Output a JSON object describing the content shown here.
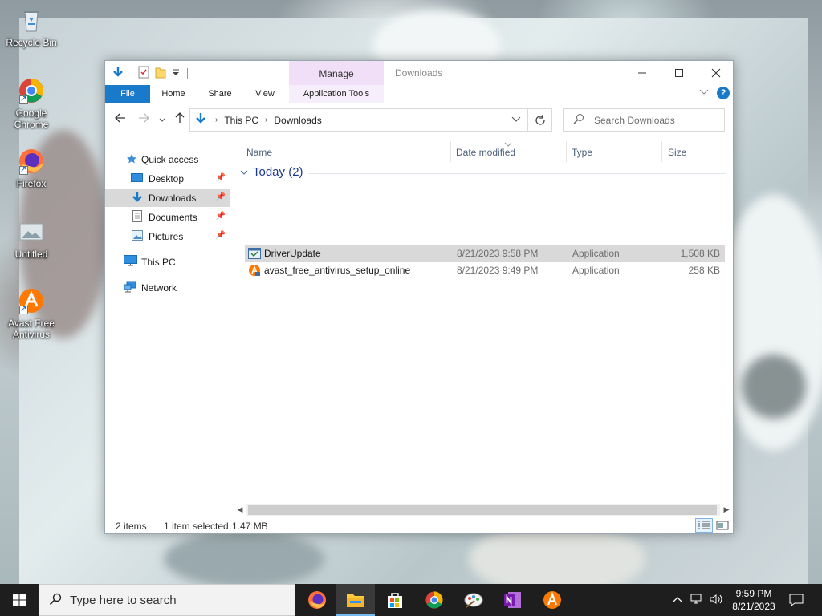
{
  "desktop": {
    "icons": [
      {
        "label": "Recycle Bin"
      },
      {
        "label": "Google Chrome"
      },
      {
        "label": "Firefox"
      },
      {
        "label": "Untitled"
      },
      {
        "label": "Avast Free Antivirus"
      }
    ]
  },
  "window": {
    "title": "Downloads",
    "manage_tab": "Manage",
    "ribbon_tabs": {
      "file": "File",
      "home": "Home",
      "share": "Share",
      "view": "View",
      "app_tools": "Application Tools"
    },
    "address": {
      "crumbs": [
        "This PC",
        "Downloads"
      ]
    },
    "search": {
      "placeholder": "Search Downloads"
    },
    "nav": {
      "quick_access": "Quick access",
      "desktop": "Desktop",
      "downloads": "Downloads",
      "documents": "Documents",
      "pictures": "Pictures",
      "this_pc": "This PC",
      "network": "Network"
    },
    "columns": {
      "name": "Name",
      "date": "Date modified",
      "type": "Type",
      "size": "Size"
    },
    "group": {
      "label": "Today (2)"
    },
    "files": [
      {
        "name": "DriverUpdate",
        "date": "8/21/2023 9:58 PM",
        "type": "Application",
        "size": "1,508 KB",
        "selected": true
      },
      {
        "name": "avast_free_antivirus_setup_online",
        "date": "8/21/2023 9:49 PM",
        "type": "Application",
        "size": "258 KB",
        "selected": false
      }
    ],
    "status": {
      "items": "2 items",
      "selected": "1 item selected",
      "size": "1.47 MB"
    }
  },
  "taskbar": {
    "search_placeholder": "Type here to search",
    "apps": [
      "firefox-icon",
      "file-explorer-icon",
      "store-icon",
      "chrome-icon",
      "paint-icon",
      "onenote-icon",
      "avast-icon"
    ],
    "time": "9:59 PM",
    "date": "8/21/2023"
  },
  "colors": {
    "accent": "#1979ca",
    "manage_tab": "#f0dff7",
    "selection": "#d9d9d9",
    "group_header": "#1e3a8a"
  }
}
